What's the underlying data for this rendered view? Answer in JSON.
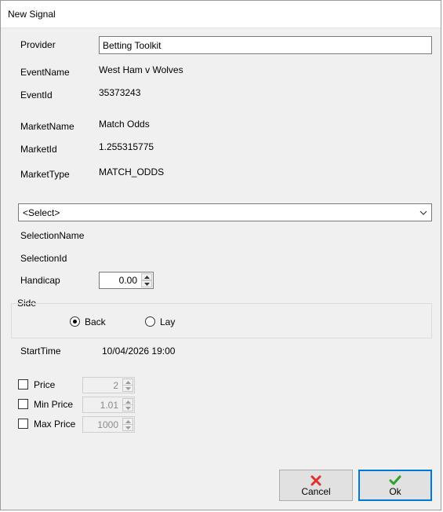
{
  "window": {
    "title": "New Signal"
  },
  "form": {
    "provider_label": "Provider",
    "provider_value": "Betting Toolkit",
    "event_name_label": "EventName",
    "event_name_value": "West Ham v Wolves",
    "event_id_label": "EventId",
    "event_id_value": "35373243",
    "market_name_label": "MarketName",
    "market_name_value": "Match Odds",
    "market_id_label": "MarketId",
    "market_id_value": "1.255315775",
    "market_type_label": "MarketType",
    "market_type_value": "MATCH_ODDS",
    "selection_combo_value": "<Select>",
    "selection_name_label": "SelectionName",
    "selection_id_label": "SelectionId",
    "handicap_label": "Handicap",
    "handicap_value": "0.00",
    "side_label": "Side",
    "side_options": [
      {
        "label": "Back",
        "checked": true
      },
      {
        "label": "Lay",
        "checked": false
      }
    ],
    "start_time_label": "StartTime",
    "start_time_value": "10/04/2026 19:00"
  },
  "price_limits": [
    {
      "label": "Price",
      "value": "2",
      "checked": false
    },
    {
      "label": "Min Price",
      "value": "1.01",
      "checked": false
    },
    {
      "label": "Max Price",
      "value": "1000",
      "checked": false
    }
  ],
  "buttons": {
    "cancel_label": "Cancel",
    "ok_label": "Ok"
  },
  "icons": {
    "cancel": "red-x-icon",
    "ok": "green-check-icon"
  },
  "colors": {
    "default_button_border": "#0078d7",
    "cancel_icon": "#e03131",
    "ok_icon": "#2fa12f"
  }
}
